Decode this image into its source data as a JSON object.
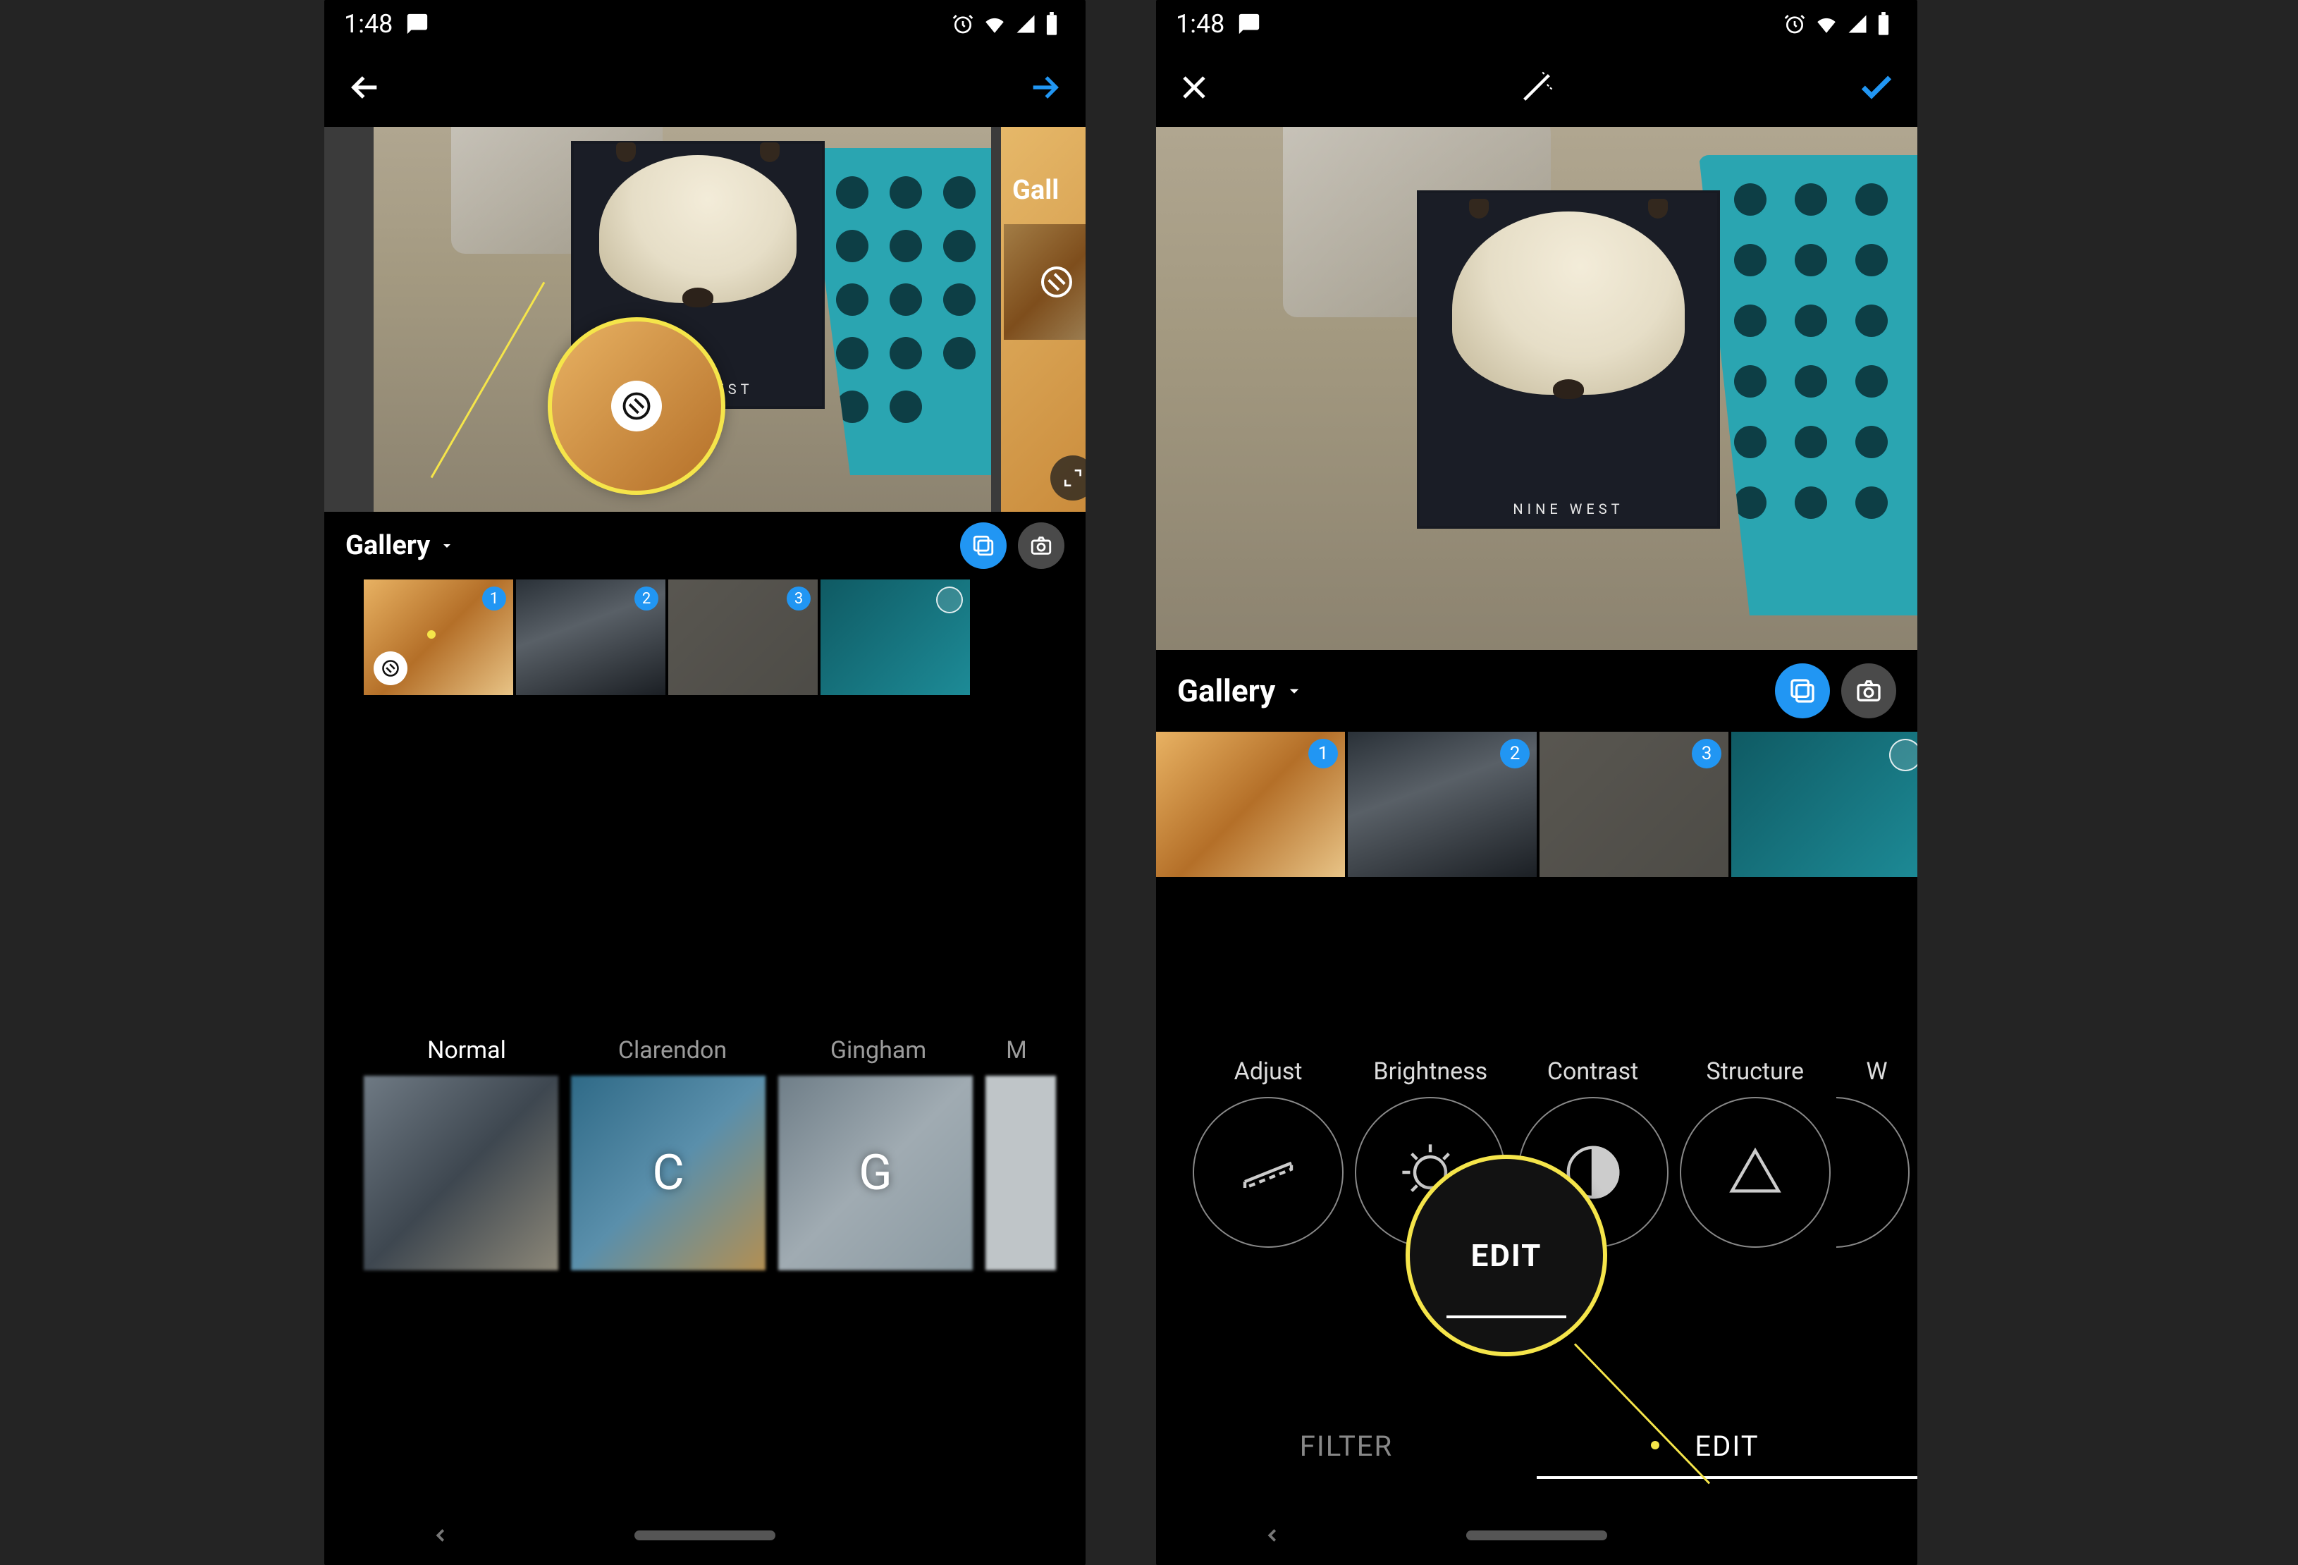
{
  "status": {
    "time": "1:48"
  },
  "colors": {
    "accent": "#2196f3",
    "highlight": "#f5e54a"
  },
  "photo": {
    "brand_label": "NINE WEST"
  },
  "left_screen": {
    "gallery_label": "Gallery",
    "gallery_peek_label": "Gall",
    "thumbs": [
      {
        "index": 1,
        "badge": "1",
        "has_edit_icon": true
      },
      {
        "index": 2,
        "badge": "2"
      },
      {
        "index": 3,
        "badge": "3"
      },
      {
        "index": 4,
        "badge": null
      }
    ],
    "filters": [
      {
        "label": "Normal",
        "letter": "",
        "selected": true
      },
      {
        "label": "Clarendon",
        "letter": "C",
        "selected": false
      },
      {
        "label": "Gingham",
        "letter": "G",
        "selected": false
      },
      {
        "label": "M",
        "letter": "",
        "selected": false
      }
    ]
  },
  "right_screen": {
    "gallery_label": "Gallery",
    "thumbs": [
      {
        "index": 1,
        "badge": "1"
      },
      {
        "index": 2,
        "badge": "2"
      },
      {
        "index": 3,
        "badge": "3"
      },
      {
        "index": 4,
        "badge": null
      }
    ],
    "tools": [
      {
        "label": "Adjust"
      },
      {
        "label": "Brightness"
      },
      {
        "label": "Contrast"
      },
      {
        "label": "Structure"
      },
      {
        "label_peek": "W"
      }
    ],
    "tabs": {
      "filter": "FILTER",
      "edit": "EDIT",
      "selected": "edit"
    }
  },
  "callouts": {
    "edit_label": "EDIT"
  }
}
